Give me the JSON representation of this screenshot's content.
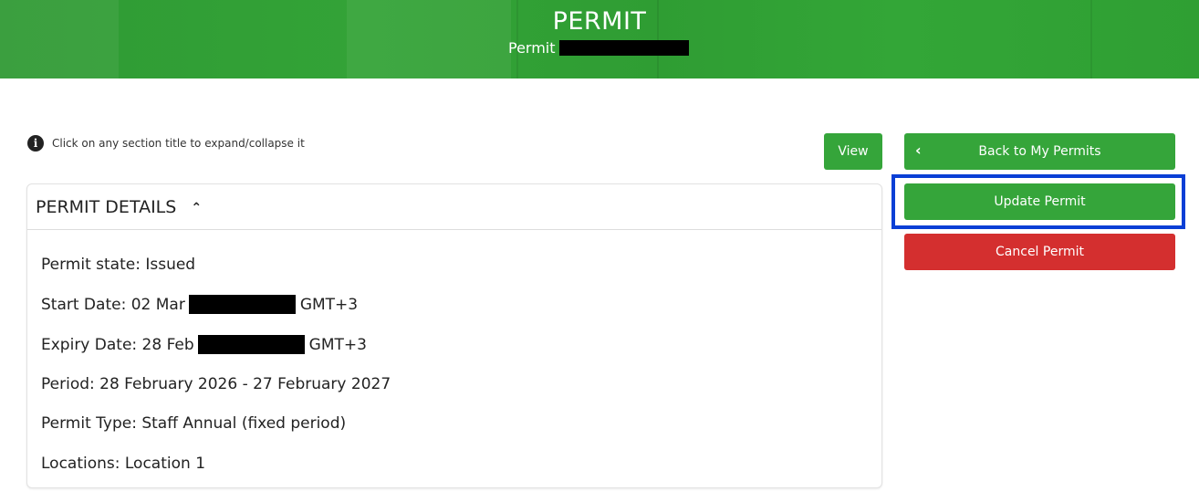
{
  "header": {
    "title": "PERMIT",
    "subtitle_label": "Permit"
  },
  "hint": {
    "icon": "info-icon",
    "text": "Click on any section title to expand/collapse it"
  },
  "actions": {
    "view_label": "View",
    "back_label": "Back to My Permits",
    "update_label": "Update Permit",
    "cancel_label": "Cancel Permit"
  },
  "colors": {
    "brand_green": "#35a53a",
    "danger_red": "#d42f2f",
    "highlight_blue": "#0a3fd6"
  },
  "details": {
    "section_title": "PERMIT DETAILS",
    "state": "Permit state: Issued",
    "start_prefix": "Start Date: 02 Mar",
    "start_suffix": "GMT+3",
    "expiry_prefix": "Expiry Date: 28 Feb",
    "expiry_suffix": "GMT+3",
    "period": "Period: 28 February 2026 - 27 February 2027",
    "type": "Permit Type: Staff Annual (fixed period)",
    "locations": "Locations: Location 1"
  }
}
